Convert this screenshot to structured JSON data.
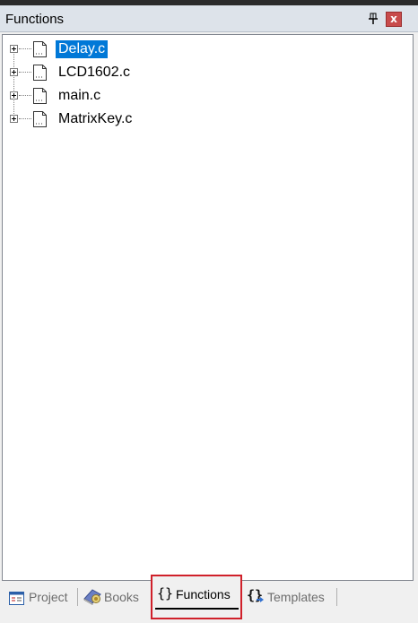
{
  "panel": {
    "title": "Functions",
    "pin_icon": "pin-icon",
    "close_label": "x"
  },
  "tree": {
    "files": [
      {
        "name": "Delay.c",
        "selected": true
      },
      {
        "name": "LCD1602.c",
        "selected": false
      },
      {
        "name": "main.c",
        "selected": false
      },
      {
        "name": "MatrixKey.c",
        "selected": false
      }
    ]
  },
  "tabs": {
    "project": "Project",
    "books": "Books",
    "functions": "Functions",
    "functions_glyph": "{}",
    "templates": "Templates",
    "active": "functions",
    "highlight_color": "#d0202a"
  },
  "colors": {
    "selection": "#0078d7",
    "titlebar": "#dde3ea"
  }
}
